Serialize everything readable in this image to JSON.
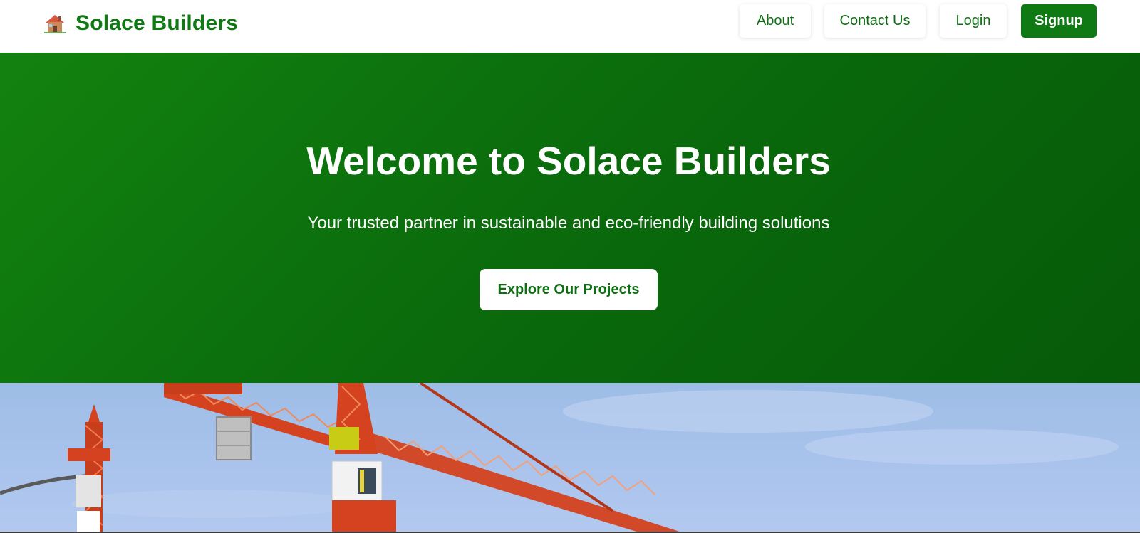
{
  "brand": {
    "name": "Solace Builders",
    "icon": "house-icon"
  },
  "nav": {
    "about": "About",
    "contact": "Contact Us",
    "login": "Login",
    "signup": "Signup"
  },
  "hero": {
    "title": "Welcome to Solace Builders",
    "subtitle": "Your trusted partner in sustainable and eco-friendly building solutions",
    "cta": "Explore Our Projects"
  },
  "colors": {
    "brand_green": "#0f7a13",
    "hero_green_light": "#12820f",
    "hero_green_dark": "#065a08",
    "sky": "#a9c3ec",
    "crane_red": "#d4421f"
  }
}
